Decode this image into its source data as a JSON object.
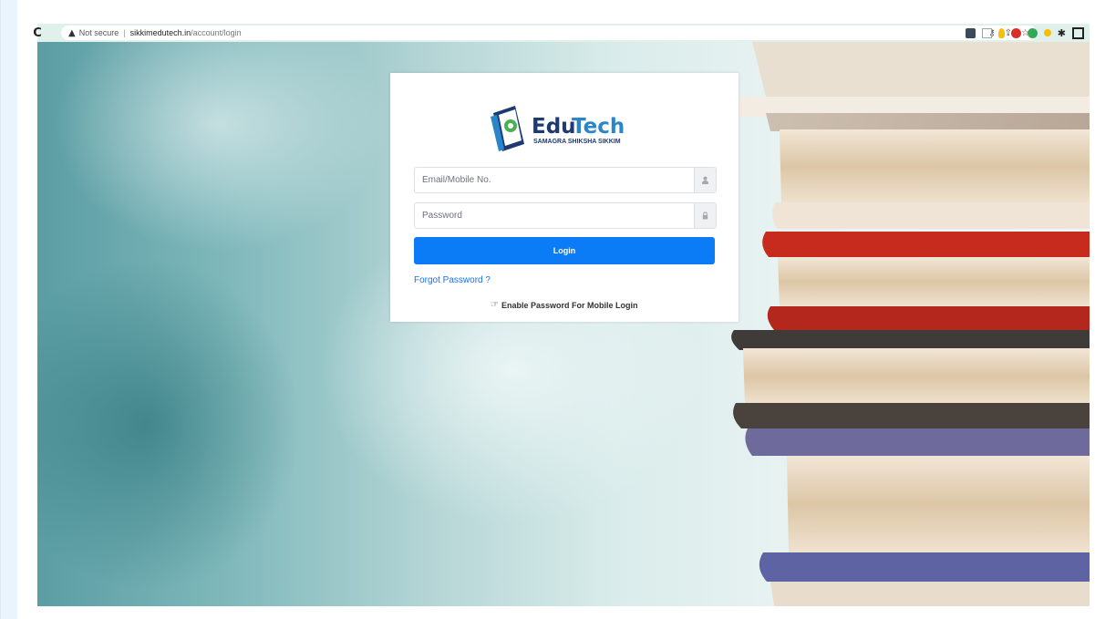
{
  "browser": {
    "security_label": "Not secure",
    "url_host": "sikkimedutech.in",
    "url_path": "/account/login"
  },
  "logo": {
    "brand_part1": "Edu",
    "brand_part2": "Tech",
    "subtitle": "SAMAGRA SHIKSHA SIKKIM"
  },
  "login": {
    "email_placeholder": "Email/Mobile No.",
    "password_placeholder": "Password",
    "submit_label": "Login",
    "forgot_label": "Forgot Password ?",
    "enable_label": "Enable Password For Mobile Login"
  },
  "colors": {
    "primary_button": "#0b7cf6",
    "link": "#1a73e8",
    "brand_dark": "#1e3a73",
    "brand_light": "#2a86c8"
  }
}
